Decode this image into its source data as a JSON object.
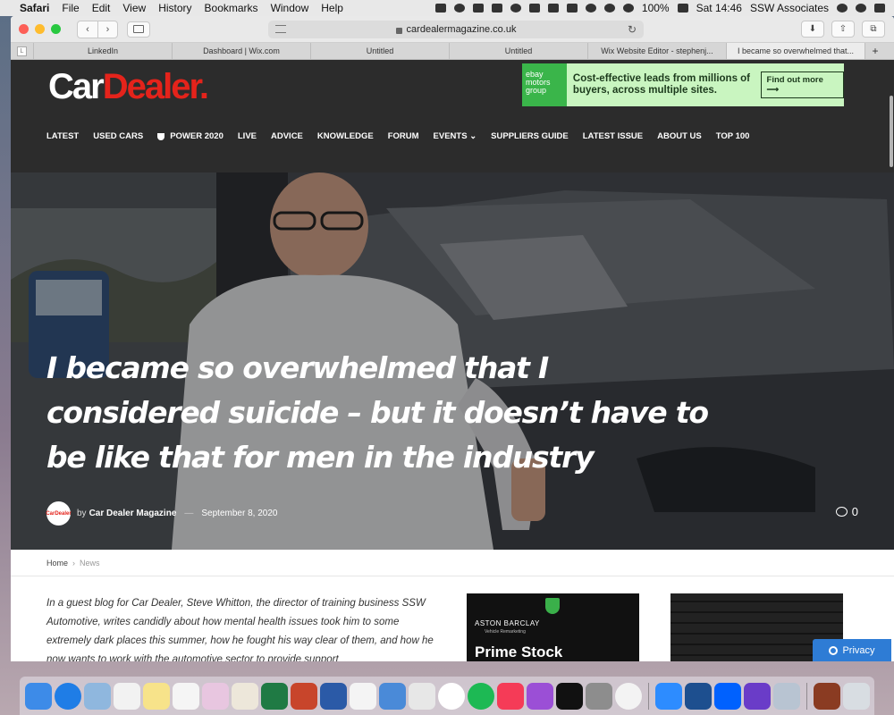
{
  "menubar": {
    "app": "Safari",
    "items": [
      "File",
      "Edit",
      "View",
      "History",
      "Bookmarks",
      "Window",
      "Help"
    ],
    "battery": "100%",
    "clock": "Sat 14:46",
    "user": "SSW Associates"
  },
  "browser": {
    "url": "cardealermagazine.co.uk",
    "pinned_tab_letter": "L",
    "tabs": [
      {
        "label": "LinkedIn"
      },
      {
        "label": "Dashboard | Wix.com"
      },
      {
        "label": "Untitled"
      },
      {
        "label": "Untitled"
      },
      {
        "label": "Wix Website Editor - stephenj..."
      },
      {
        "label": "I became so overwhelmed that..."
      }
    ],
    "new_tab": "+"
  },
  "site": {
    "logo": {
      "part1": "Car",
      "part2": "Dealer",
      "dot": "."
    },
    "ad": {
      "brand": "ebay motors group",
      "copy": "Cost-effective leads from millions of buyers, across multiple sites.",
      "cta": "Find out more ⟶"
    },
    "nav": [
      "LATEST",
      "USED CARS",
      "POWER 2020",
      "LIVE",
      "ADVICE",
      "KNOWLEDGE",
      "FORUM",
      "EVENTS ⌄",
      "SUPPLIERS GUIDE",
      "LATEST ISSUE",
      "ABOUT US",
      "TOP 100"
    ],
    "article": {
      "headline": "I became so overwhelmed that I considered suicide – but it doesn’t have to be like that for men in the industry",
      "avatar_text": "CarDealer",
      "by": "by",
      "author": "Car Dealer Magazine",
      "dash": "—",
      "date": "September 8, 2020",
      "comment_count": "0"
    },
    "breadcrumbs": {
      "home": "Home",
      "sep": "›",
      "current": "News"
    },
    "intro": "In a guest blog for Car Dealer, Steve Whitton, the director of training business SSW Automotive, writes candidly about how mental health issues took him to some extremely dark places this summer, how he fought his way clear of them, and how he now wants to work with the automotive sector to provide support",
    "side_ad": {
      "brand": "ASTON BARCLAY",
      "sub": "Vehicle Remarketing",
      "headline": "Prime Stock"
    },
    "privacy": "Privacy"
  },
  "colors": {
    "brand_red": "#e4231b",
    "header_bg": "#2c2c2c",
    "ad_green": "#c9f5c0",
    "privacy_blue": "#2e7cd5"
  }
}
